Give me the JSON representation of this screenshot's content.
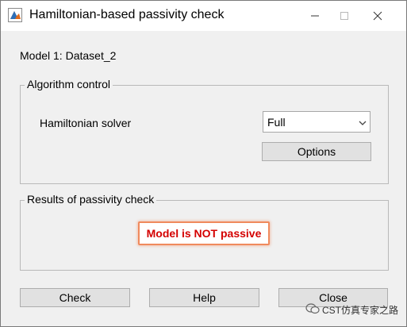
{
  "window": {
    "title": "Hamiltonian-based passivity check",
    "controls": {
      "minimize": "minimize",
      "maximize": "maximize",
      "close": "close"
    }
  },
  "model_label": "Model 1: Dataset_2",
  "algorithm_control": {
    "title": "Algorithm control",
    "solver_label": "Hamiltonian solver",
    "solver_value": "Full",
    "options_label": "Options"
  },
  "results": {
    "title": "Results of passivity check",
    "status_text": "Model is NOT passive",
    "status_color": "#d40000",
    "highlight_color": "#f08a5d"
  },
  "buttons": {
    "check": "Check",
    "help": "Help",
    "close": "Close"
  },
  "watermark": {
    "text": "CST仿真专家之路"
  },
  "icons": {
    "app": "matlab-figure-icon",
    "dropdown": "chevron-down-icon",
    "watermark": "wechat-icon"
  }
}
